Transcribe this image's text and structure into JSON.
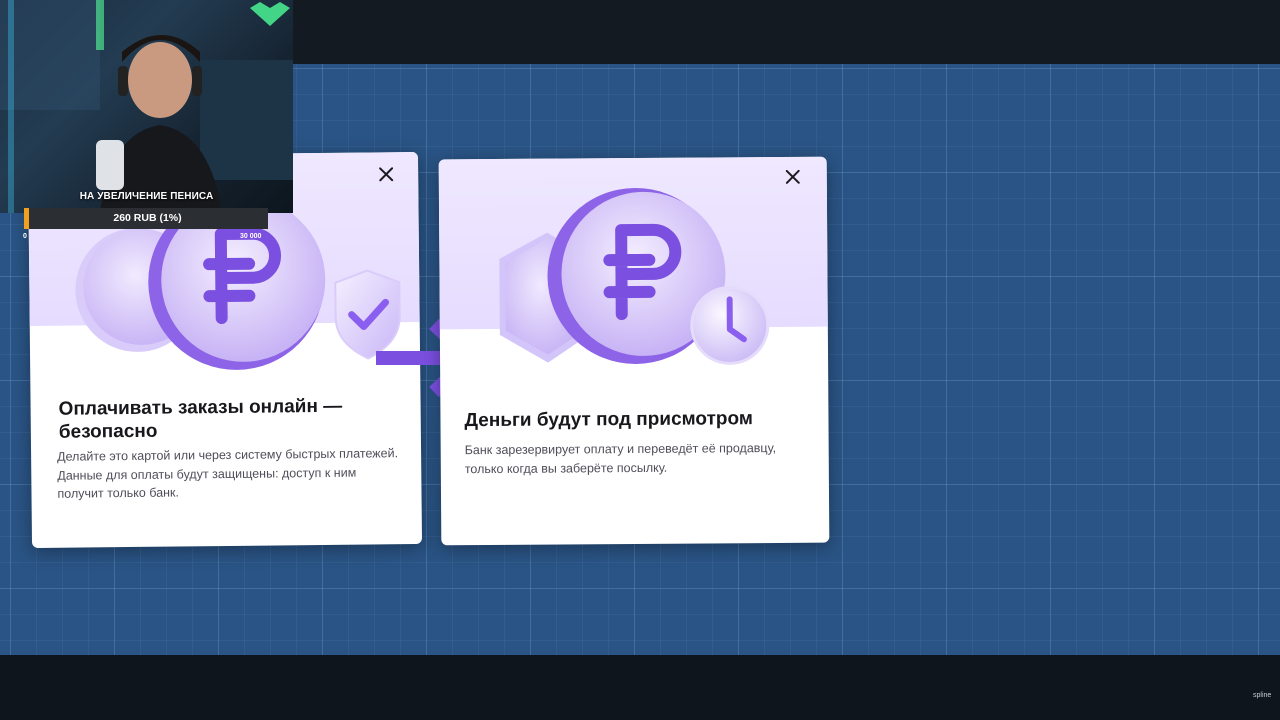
{
  "overlay": {
    "donation_title": "НА УВЕЛИЧЕНИЕ ПЕНИСА",
    "goal_amount": "260 RUB (1%)",
    "goal_progress": 0.01,
    "goal_min": "0",
    "goal_max": "30 000"
  },
  "cards": [
    {
      "title": "Оплачивать заказы онлайн — безопасно",
      "text": "Делайте это картой или через систему быстрых платежей. Данные для оплаты будут защищены: доступ к ним получит только банк.",
      "icon": "ruble-shield-icon"
    },
    {
      "title": "Деньги будут под присмотром",
      "text": "Банк зарезервирует оплату и переведёт её продавцу, только когда вы заберёте посылку.",
      "icon": "ruble-clock-icon"
    }
  ],
  "colors": {
    "accent": "#7b4fe0",
    "canvas": "#2a5485",
    "goal": "#f0a020"
  },
  "watermark": "spline"
}
